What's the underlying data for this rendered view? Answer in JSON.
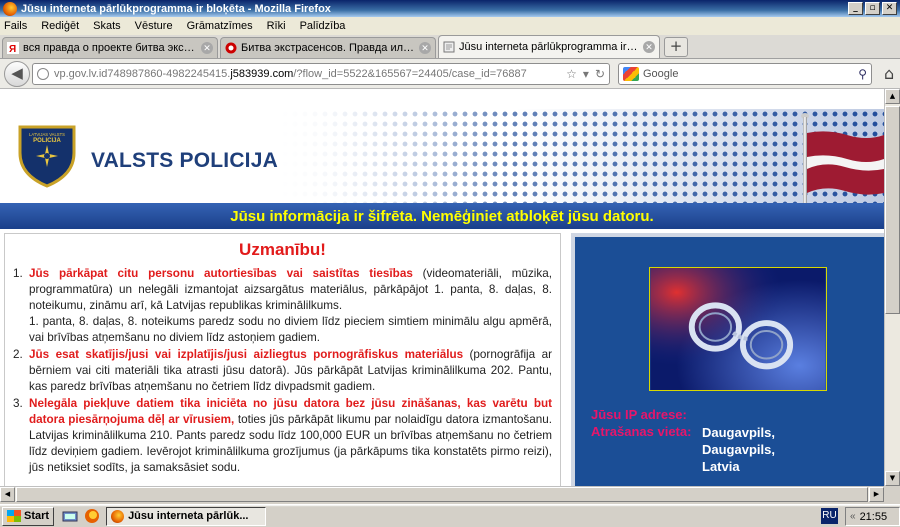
{
  "window": {
    "title": "Jūsu interneta pārlūkprogramma ir bloķēta - Mozilla Firefox",
    "controls": {
      "minimize": "_",
      "maximize": "▫",
      "close": "✕"
    }
  },
  "menu": [
    "Fails",
    "Rediģēt",
    "Skats",
    "Vēsture",
    "Grāmatzīmes",
    "Rīki",
    "Palīdzība"
  ],
  "tabs": [
    {
      "label": "вся правда о проекте битва экстрасенсов",
      "icon": "yandex-icon",
      "active": false
    },
    {
      "label": "Битва экстрасенсов. Правда или ложь...",
      "icon": "site-icon",
      "active": false
    },
    {
      "label": "Jūsu interneta pārlūkprogramma ir bloķēta",
      "icon": "page-icon",
      "active": true
    }
  ],
  "newtab_label": "+",
  "nav": {
    "url_prefix": "vp.gov.lv.id748987860-4982245415.",
    "url_domain": "j583939.com",
    "url_suffix": "/?flow_id=5522&165567=24405/case_id=76887",
    "search_placeholder": "Google"
  },
  "page": {
    "brand": "VALSTS POLICIJA",
    "logo_text": "LATVIJAS VALSTS",
    "logo_word": "POLICIJA",
    "banner": "Jūsu informācija ir šifrēta. Nemēģiniet atbloķēt jūsu datoru.",
    "warning_title": "Uzmanību!",
    "items": [
      {
        "num": "1.",
        "bold": "Jūs pārkāpat citu personu autortiesības vai saistītas tiesības",
        "text": " (videomateriāli, mūzika, programmatūra) un nelegāli izmantojat aizsargātus materiālus, pārkāpājot 1. panta, 8. daļas, 8. noteikumu, zināmu arī, kā Latvijas republikas kriminālilkums.",
        "extra": "1. panta, 8. daļas, 8. noteikums paredz sodu no diviem līdz pieciem simtiem minimālu algu apmērā, vai brīvības atņemšanu no diviem līdz astoņiem gadiem."
      },
      {
        "num": "2.",
        "bold": "Jūs esat skatījis/jusi vai izplatījis/jusi aizliegtus pornogrāfiskus materiālus",
        "text": " (pornogrāfija ar bērniem vai citi materiāli tika atrasti jūsu datorā). Jūs pārkāpāt Latvijas kriminālilkuma 202. Pantu, kas paredz brīvības atņemšanu no četriem līdz divpadsmit gadiem.",
        "extra": ""
      },
      {
        "num": "3.",
        "bold": "Nelegāla piekļuve datiem tika iniciēta no jūsu datora bez jūsu zināšanas, kas varētu but datora piesārņojuma dēļ ar vīrusiem,",
        "text": " toties jūs pārkāpāt likumu par nolaidīgu datora izmantošanu. Latvijas kriminālilkuma 210. Pants paredz sodu līdz 100,000 EUR un brīvības atņemšanu no četriem līdz deviņiem gadiem. Ievērojot kriminālilkuma grozījumus (ja pārkāpums tika konstatēts pirmo reizi), jūs netiksiet sodīts, ja samaksāsiet sodu.",
        "extra": ""
      }
    ],
    "ip_label": "Jūsu IP adrese:",
    "location_label": "Atrašanas vieta:",
    "location_value": [
      "Daugavpils,",
      "Daugavpils,",
      "Latvia"
    ]
  },
  "taskbar": {
    "start": "Start",
    "task": "Jūsu interneta pārlūk...",
    "lang": "RU",
    "clock": "21:55"
  },
  "colors": {
    "brand_blue": "#1f3f7a",
    "banner_yellow": "#ffff00",
    "warning_red": "#e21b1b",
    "panel_blue": "#1b4e96",
    "ip_pink": "#e8156a"
  }
}
